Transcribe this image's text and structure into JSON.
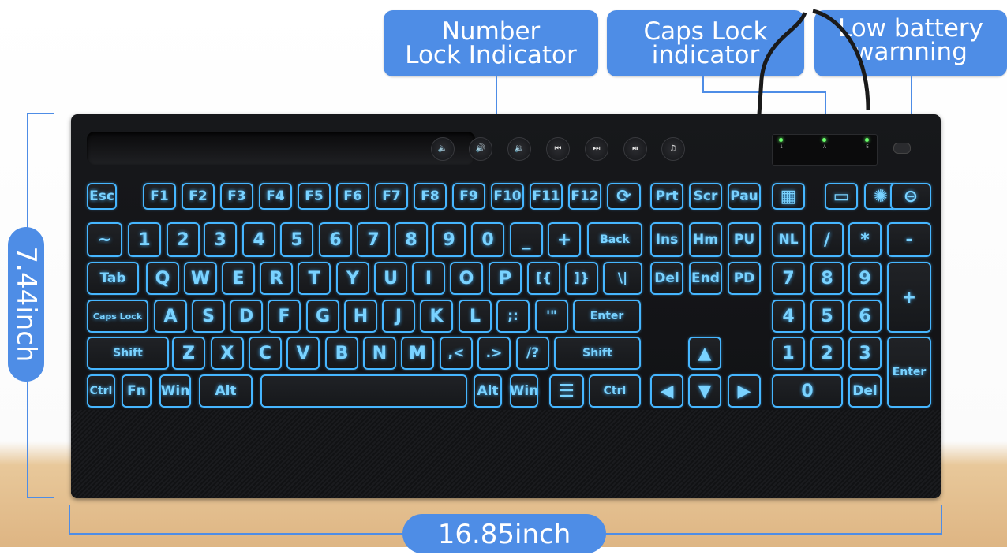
{
  "callouts": {
    "numlock": [
      "Number",
      "Lock Indicator"
    ],
    "capslock": [
      "Caps Lock",
      "indicator"
    ],
    "battery": [
      "Low battery",
      "warnning"
    ]
  },
  "dimensions": {
    "height": "7.44inch",
    "width": "16.85inch"
  },
  "indicator_panel": {
    "labels": [
      "1",
      "A",
      "5"
    ]
  },
  "media_keys": [
    "mute-icon",
    "volume-up-icon",
    "volume-down-icon",
    "previous-track-icon",
    "next-track-icon",
    "play-pause-icon",
    "music-icon"
  ],
  "media_glyphs": [
    "🔈",
    "🔊",
    "🔉",
    "⏮",
    "⏭",
    "⏯",
    "♫"
  ],
  "rows": {
    "function": [
      "Esc",
      "F1",
      "F2",
      "F3",
      "F4",
      "F5",
      "F6",
      "F7",
      "F8",
      "F9",
      "F10",
      "F11",
      "F12",
      "⟳",
      "Prt",
      "Scr",
      "Pau",
      "▦",
      "▭",
      "✺",
      "⊖"
    ],
    "number": [
      "~",
      "1",
      "2",
      "3",
      "4",
      "5",
      "6",
      "7",
      "8",
      "9",
      "0",
      "_",
      "+",
      "Back",
      "Ins",
      "Hm",
      "PU",
      "NL",
      "/",
      "*",
      "-"
    ],
    "top": [
      "Tab",
      "Q",
      "W",
      "E",
      "R",
      "T",
      "Y",
      "U",
      "I",
      "O",
      "P",
      "[{",
      "]}",
      "\\|",
      "Del",
      "End",
      "PD",
      "7",
      "8",
      "9",
      "+"
    ],
    "home": [
      "Caps Lock",
      "A",
      "S",
      "D",
      "F",
      "G",
      "H",
      "J",
      "K",
      "L",
      ";:",
      "'\"",
      "Enter",
      "4",
      "5",
      "6"
    ],
    "shift": [
      "Shift",
      "Z",
      "X",
      "C",
      "V",
      "B",
      "N",
      "M",
      ",<",
      ".>",
      "/?",
      "Shift",
      "▲",
      "1",
      "2",
      "3",
      "Enter"
    ],
    "bottom": [
      "Ctrl",
      "Fn",
      "Win",
      "Alt",
      "",
      "Alt",
      "Win",
      "☰",
      "Ctrl",
      "◀",
      "▼",
      "▶",
      "0",
      "Del"
    ]
  },
  "colors": {
    "backlight": "#46b6ff",
    "callout": "#4e8de6",
    "led": "#6aff6a"
  }
}
